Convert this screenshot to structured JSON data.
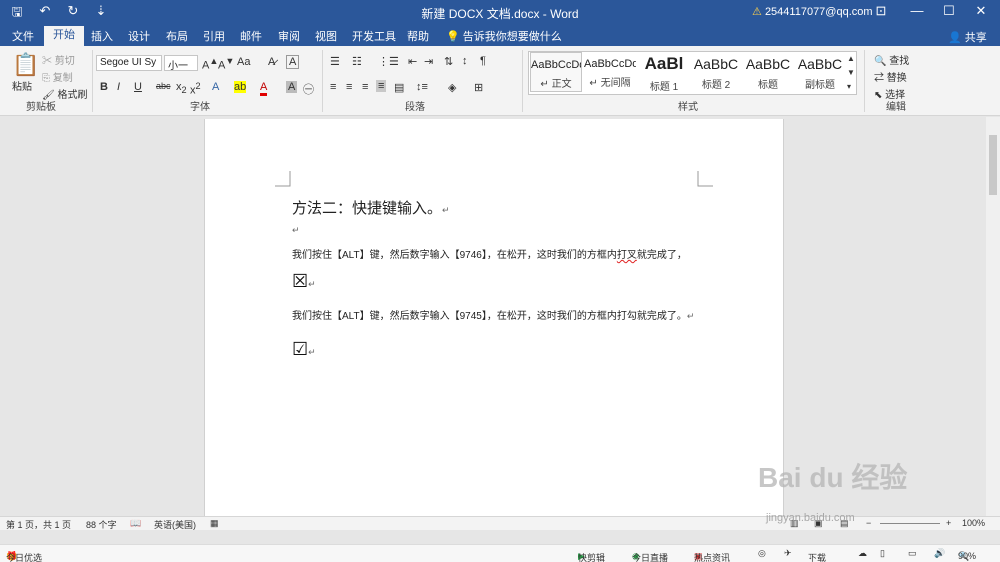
{
  "titlebar": {
    "title": "新建 DOCX 文档.docx  -  Word",
    "account": "2544117077@qq.com",
    "qat": {
      "save": "🖫",
      "undo": "↶",
      "redo": "↻",
      "customize": "⇣"
    },
    "window_buttons": {
      "ribbon_options": "⊡",
      "minimize": "—",
      "maximize": "☐",
      "close": "✕"
    }
  },
  "tabs": [
    "文件",
    "开始",
    "插入",
    "设计",
    "布局",
    "引用",
    "邮件",
    "审阅",
    "视图",
    "开发工具",
    "帮助"
  ],
  "tell_me": "告诉我你想要做什么",
  "share": "共享",
  "clipboard": {
    "paste": "粘贴",
    "cut": "剪切",
    "copy": "复制",
    "format_painter": "格式刷",
    "label": "剪贴板"
  },
  "font": {
    "family": "Segoe UI Sy",
    "size": "小一",
    "label": "字体"
  },
  "paragraph": {
    "label": "段落"
  },
  "styles": {
    "items": [
      {
        "sample": "AaBbCcDd",
        "name": "↵ 正文"
      },
      {
        "sample": "AaBbCcDd",
        "name": "↵ 无间隔"
      },
      {
        "sample": "AaBl",
        "name": "标题 1"
      },
      {
        "sample": "AaBbC",
        "name": "标题 2"
      },
      {
        "sample": "AaBbC",
        "name": "标题"
      },
      {
        "sample": "AaBbC",
        "name": "副标题"
      }
    ],
    "label": "样式"
  },
  "editing": {
    "find": "查找",
    "replace": "替换",
    "select": "选择",
    "label": "编辑"
  },
  "document": {
    "heading": "方法二：快捷键输入。",
    "para1_prefix": "我们按住【ALT】键，然后数字输入【9746】，在松开，这时我们的方框内",
    "para1_squiggle": "打叉",
    "para1_suffix": "就完成了，",
    "symbol1": "☒",
    "para2": "我们按住【ALT】键，然后数字输入【9745】，在松开，这时我们的方框内打勾就完成了。",
    "symbol2": "☑",
    "para_mark": "↵"
  },
  "statusbar": {
    "page": "第 1 页，共 1 页",
    "words": "88 个字",
    "language": "英语(美国)",
    "zoom": "100%"
  },
  "taskbar": {
    "today": "今日优选",
    "quick_clip": "快剪辑",
    "live": "今日直播",
    "hot": "热点资讯",
    "download": "下载",
    "zoom": "90%"
  },
  "watermark": {
    "text": "Bai du 经验",
    "sub": "jingyan.baidu.com"
  }
}
